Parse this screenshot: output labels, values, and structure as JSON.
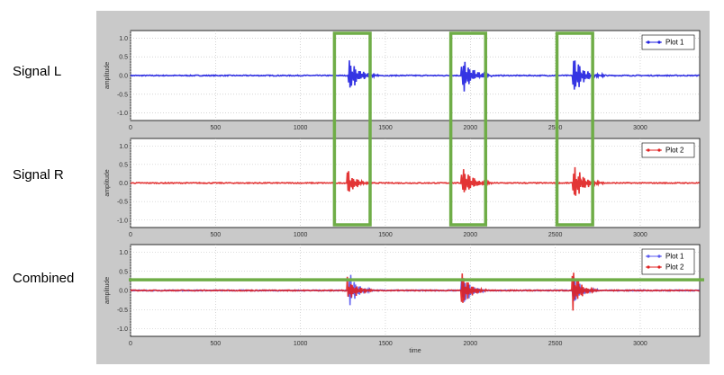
{
  "row_labels": [
    "Signal L",
    "Signal R",
    "Combined"
  ],
  "chart_data": [
    {
      "type": "line",
      "title": "",
      "xlabel": "",
      "ylabel": "amplitude",
      "xlim": [
        0,
        3350
      ],
      "ylim": [
        -1.2,
        1.2
      ],
      "x_ticks": [
        0,
        500,
        1000,
        1500,
        2000,
        2500,
        3000
      ],
      "y_ticks": [
        1.0,
        0.5,
        0.0,
        -0.5,
        -1.0
      ],
      "y_tick_labels": [
        "1.0",
        "0.5",
        "0.0",
        "-0.5",
        "-1.0"
      ],
      "grid": true,
      "legend": "top-right",
      "series": [
        {
          "name": "Plot 1",
          "color": "#1f1fe0",
          "marker": "dot",
          "bursts": [
            {
              "x": 1280,
              "amp": 0.52,
              "dur": 180
            },
            {
              "x": 1945,
              "amp": 0.55,
              "dur": 180
            },
            {
              "x": 2600,
              "amp": 0.52,
              "dur": 200
            }
          ]
        }
      ],
      "highlights": [
        {
          "x0": 1200,
          "x1": 1410,
          "color": "#6fad47"
        },
        {
          "x0": 1885,
          "x1": 2090,
          "color": "#6fad47"
        },
        {
          "x0": 2510,
          "x1": 2720,
          "color": "#6fad47"
        }
      ]
    },
    {
      "type": "line",
      "title": "",
      "xlabel": "",
      "ylabel": "amplitude",
      "xlim": [
        0,
        3350
      ],
      "ylim": [
        -1.2,
        1.2
      ],
      "x_ticks": [
        0,
        500,
        1000,
        1500,
        2000,
        2500,
        3000
      ],
      "y_ticks": [
        1.0,
        0.5,
        0.0,
        -0.5,
        -1.0
      ],
      "y_tick_labels": [
        "1.0",
        "0.5",
        "0.0",
        "-0.5",
        "-1.0"
      ],
      "grid": true,
      "legend": "top-right",
      "series": [
        {
          "name": "Plot 2",
          "color": "#e02020",
          "marker": "dot",
          "bursts": [
            {
              "x": 1275,
              "amp": 0.33,
              "dur": 160
            },
            {
              "x": 1945,
              "amp": 0.52,
              "dur": 180
            },
            {
              "x": 2600,
              "amp": 0.52,
              "dur": 200
            }
          ]
        }
      ]
    },
    {
      "type": "line",
      "title": "",
      "xlabel": "time",
      "ylabel": "amplitude",
      "xlim": [
        0,
        3350
      ],
      "ylim": [
        -1.2,
        1.2
      ],
      "x_ticks": [
        0,
        500,
        1000,
        1500,
        2000,
        2500,
        3000
      ],
      "y_ticks": [
        1.0,
        0.5,
        0.0,
        -0.5,
        -1.0
      ],
      "y_tick_labels": [
        "1.0",
        "0.5",
        "0.0",
        "-0.5",
        "-1.0"
      ],
      "grid": true,
      "legend": "top-right",
      "series": [
        {
          "name": "Plot 1",
          "color": "#5a5af0",
          "marker": "dot",
          "bursts": [
            {
              "x": 1280,
              "amp": 0.48,
              "dur": 150
            },
            {
              "x": 1945,
              "amp": 0.5,
              "dur": 150
            },
            {
              "x": 2600,
              "amp": 0.5,
              "dur": 150
            }
          ]
        },
        {
          "name": "Plot 2",
          "color": "#e02020",
          "marker": "dot",
          "bursts": [
            {
              "x": 1275,
              "amp": 0.35,
              "dur": 150
            },
            {
              "x": 1945,
              "amp": 0.5,
              "dur": 150
            },
            {
              "x": 2600,
              "amp": 0.5,
              "dur": 150
            }
          ]
        }
      ],
      "threshold": {
        "y": 0.28,
        "color": "#6fad47"
      }
    }
  ]
}
